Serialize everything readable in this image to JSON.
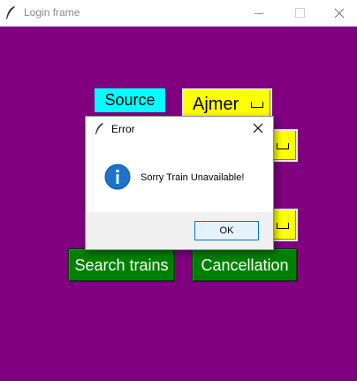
{
  "window": {
    "title": "Login frame",
    "controls": {
      "minimize": "minimize-icon",
      "maximize": "maximize-icon",
      "close": "close-icon"
    }
  },
  "colors": {
    "background": "#800080",
    "label_bg": "#00ffff",
    "option_bg": "#ffff00",
    "button_bg": "#008000",
    "button_text": "#ffffff"
  },
  "form": {
    "source_label": "Source",
    "source_value": "Ajmer",
    "search_button": "Search trains",
    "cancel_button": "Cancellation"
  },
  "dialog": {
    "title": "Error",
    "message": "Sorry Train Unavailable!",
    "ok_button": "OK",
    "icon": "info-icon"
  }
}
